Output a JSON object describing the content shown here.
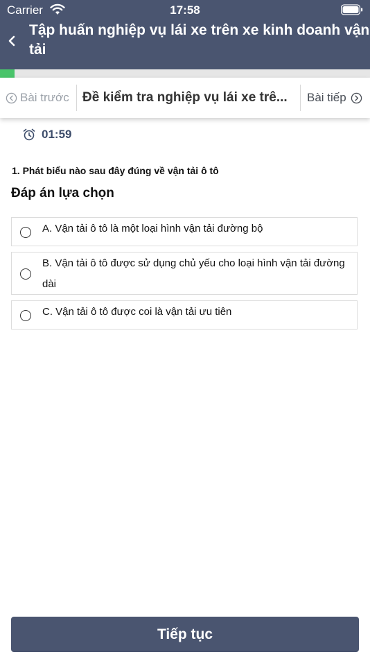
{
  "status_bar": {
    "carrier": "Carrier",
    "time": "17:58"
  },
  "header": {
    "title_line1": "Tập huấn nghiệp vụ lái xe trên xe kinh doanh vận",
    "title_line2": "tải"
  },
  "progress": {
    "fraction": 0.04,
    "color": "#49c46a"
  },
  "lesson_nav": {
    "prev_label": "Bài trước",
    "lesson_title": "Đề kiểm tra nghiệp vụ lái xe trê...",
    "next_label": "Bài tiếp"
  },
  "timer": {
    "value": "01:59"
  },
  "question": {
    "text": "1.  Phát biểu nào sau đây đúng về vận tải ô tô",
    "answers_heading": "Đáp án lựa chọn",
    "options": [
      {
        "label": "A. Vận tải ô tô là một loại hình vận tải đường bộ"
      },
      {
        "label": "B. Vận tải ô tô được sử dụng chủ yếu cho loại hình vận tải đường dài"
      },
      {
        "label": "C. Vận tải ô tô được coi là vận tải ưu tiên"
      }
    ]
  },
  "footer": {
    "continue_label": "Tiếp tục"
  },
  "colors": {
    "header": "#4a5570",
    "accent_text": "#3d4d6b",
    "progress": "#49c46a"
  }
}
